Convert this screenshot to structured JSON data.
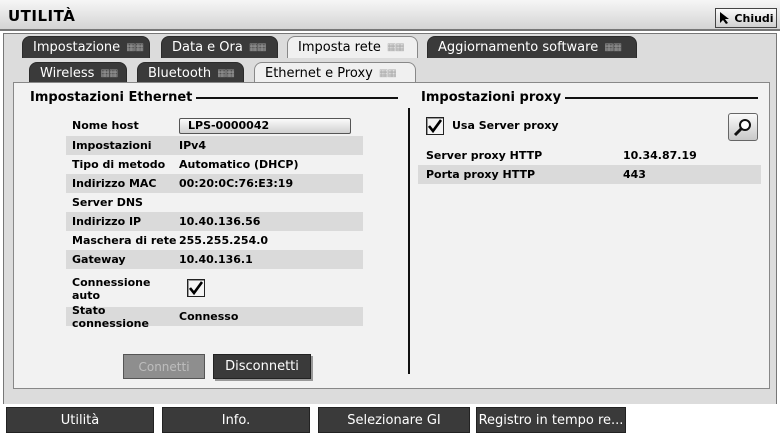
{
  "app": {
    "title": "UTILITÀ",
    "close_label": "Chiudi"
  },
  "main_tabs": [
    {
      "label": "Impostazione",
      "active": false
    },
    {
      "label": "Data e Ora",
      "active": false
    },
    {
      "label": "Imposta rete",
      "active": true
    },
    {
      "label": "Aggiornamento software",
      "active": false
    }
  ],
  "sub_tabs": [
    {
      "label": "Wireless",
      "active": false
    },
    {
      "label": "Bluetooth",
      "active": false
    },
    {
      "label": "Ethernet e Proxy",
      "active": true
    }
  ],
  "ethernet": {
    "title": "Impostazioni Ethernet",
    "host_label": "Nome host",
    "host_value": "LPS-0000042",
    "rows": [
      {
        "label": "Impostazioni",
        "value": "IPv4"
      },
      {
        "label": "Tipo di metodo",
        "value": "Automatico (DHCP)"
      },
      {
        "label": "Indirizzo MAC",
        "value": "00:20:0C:76:E3:19"
      },
      {
        "label": "Server DNS",
        "value": ""
      },
      {
        "label": "Indirizzo IP",
        "value": "10.40.136.56"
      },
      {
        "label": "Maschera di rete",
        "value": "255.255.254.0"
      },
      {
        "label": "Gateway",
        "value": "10.40.136.1"
      }
    ],
    "auto_label": "Connessione auto",
    "auto_checked": true,
    "status_label": "Stato connessione",
    "status_value": "Connesso",
    "connect_label": "Connetti",
    "disconnect_label": "Disconnetti"
  },
  "proxy": {
    "title": "Impostazioni proxy",
    "use_label": "Usa Server proxy",
    "use_checked": true,
    "rows": [
      {
        "label": "Server proxy HTTP",
        "value": "10.34.87.19"
      },
      {
        "label": "Porta proxy HTTP",
        "value": "443"
      }
    ]
  },
  "bottom_bar": [
    {
      "label": "Utilità"
    },
    {
      "label": "Info."
    },
    {
      "label": "Selezionare GI"
    },
    {
      "label": "Registro in tempo re..."
    }
  ],
  "icons": {
    "close": "cursor-arrow-icon",
    "tab_grip": "grip-icon",
    "checkbox": "check-icon",
    "search": "magnifier-icon"
  },
  "colors": {
    "tab_dark": "#3a3a3a",
    "tab_active": "#f0f0f0",
    "panel_bg": "#f2f2f2",
    "row_shade": "#dadada"
  }
}
